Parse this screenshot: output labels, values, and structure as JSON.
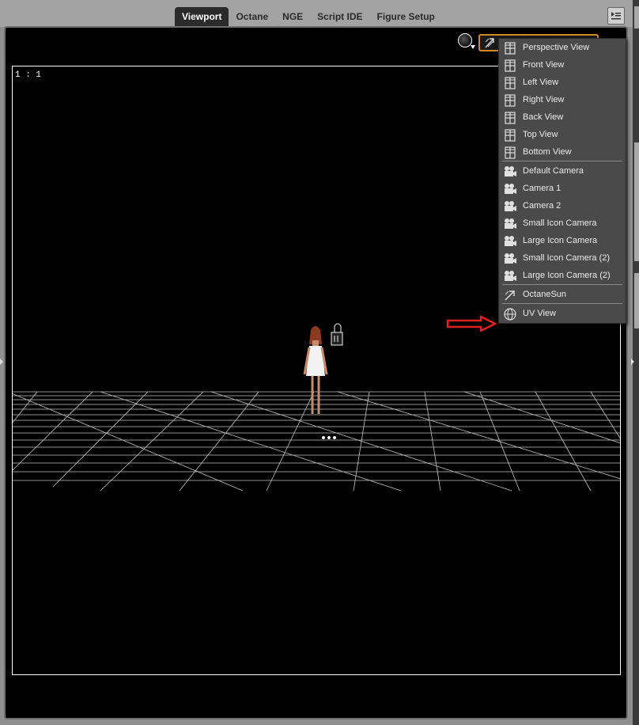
{
  "tabs": [
    {
      "label": "Viewport",
      "active": true
    },
    {
      "label": "Octane",
      "active": false
    },
    {
      "label": "NGE",
      "active": false
    },
    {
      "label": "Script IDE",
      "active": false
    },
    {
      "label": "Figure Setup",
      "active": false
    }
  ],
  "viewport": {
    "aspect_label": "1 : 1",
    "camera_selector_icon": "octane-sun-icon",
    "accent_color": "#d08a1f"
  },
  "camera_menu": {
    "items": [
      {
        "label": "Perspective View",
        "icon": "view-icon"
      },
      {
        "label": "Front View",
        "icon": "view-icon"
      },
      {
        "label": "Left View",
        "icon": "view-icon"
      },
      {
        "label": "Right View",
        "icon": "view-icon"
      },
      {
        "label": "Back View",
        "icon": "view-icon"
      },
      {
        "label": "Top View",
        "icon": "view-icon"
      },
      {
        "label": "Bottom View",
        "icon": "view-icon"
      },
      {
        "label": "Default Camera",
        "icon": "camera-icon"
      },
      {
        "label": "Camera 1",
        "icon": "camera-icon"
      },
      {
        "label": "Camera 2",
        "icon": "camera-icon"
      },
      {
        "label": "Small Icon Camera",
        "icon": "camera-icon"
      },
      {
        "label": "Large Icon Camera",
        "icon": "camera-icon"
      },
      {
        "label": "Small Icon Camera (2)",
        "icon": "camera-icon"
      },
      {
        "label": "Large Icon Camera (2)",
        "icon": "camera-icon"
      },
      {
        "label": "OctaneSun",
        "icon": "octane-sun-icon"
      },
      {
        "label": "UV View",
        "icon": "globe-icon"
      }
    ]
  },
  "annotation": {
    "arrow_color": "#e02020"
  }
}
